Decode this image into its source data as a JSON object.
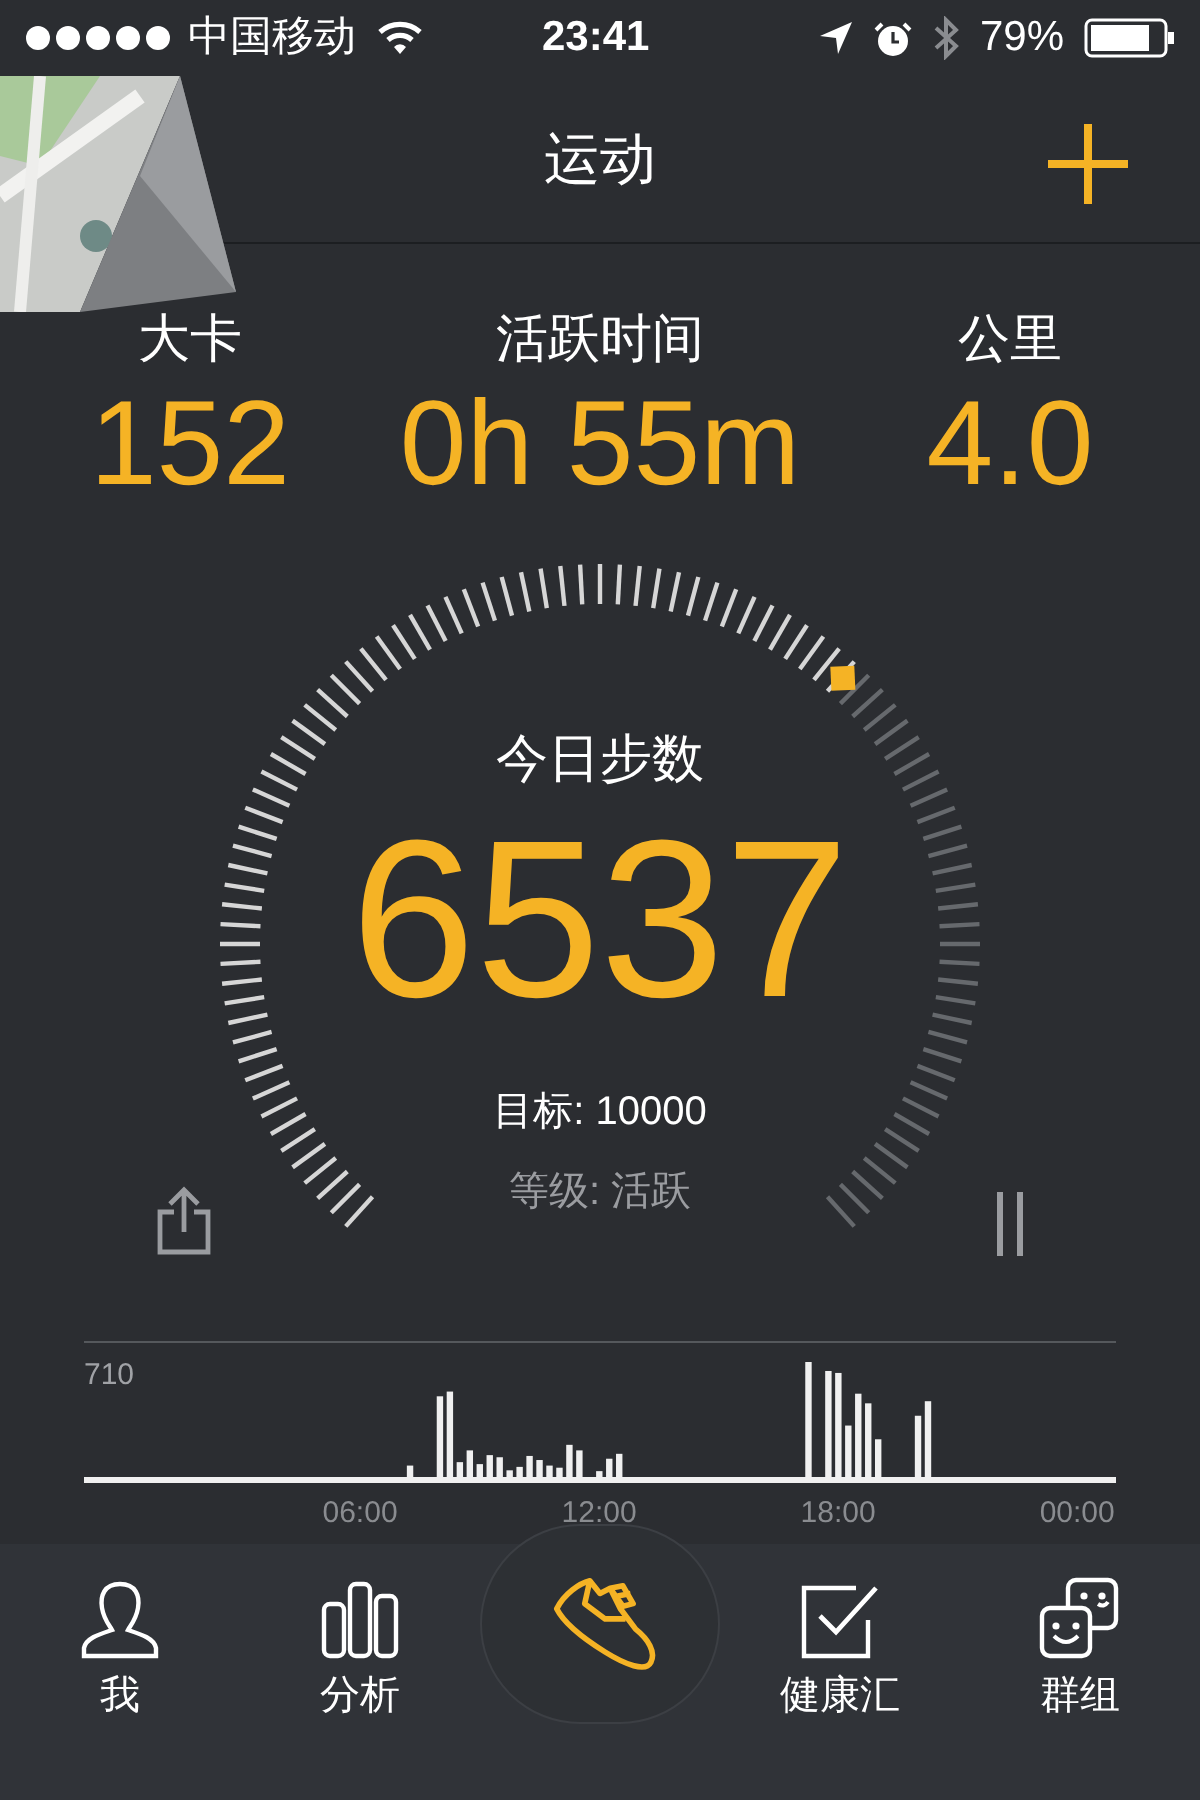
{
  "status_bar": {
    "carrier": "中国移动",
    "time": "23:41",
    "battery": "79%"
  },
  "header": {
    "title": "运动"
  },
  "stats": [
    {
      "label": "大卡",
      "value": "152"
    },
    {
      "label": "活跃时间",
      "value": "0h 55m"
    },
    {
      "label": "公里",
      "value": "4.0"
    }
  ],
  "dial": {
    "title": "今日步数",
    "steps": "6537",
    "goal": "目标: 10000",
    "grade": "等级: 活跃"
  },
  "activity_chart": {
    "peak_label": "710",
    "time_labels": [
      "06:00",
      "12:00",
      "18:00",
      "00:00"
    ]
  },
  "tab_bar": [
    {
      "kind": "person",
      "label": "我",
      "selected": false
    },
    {
      "kind": "bars",
      "label": "分析",
      "selected": false
    },
    {
      "kind": "shoe",
      "selected": true
    },
    {
      "kind": "check",
      "label": "健康汇",
      "selected": false
    },
    {
      "kind": "faces",
      "label": "群组",
      "selected": false
    }
  ]
}
